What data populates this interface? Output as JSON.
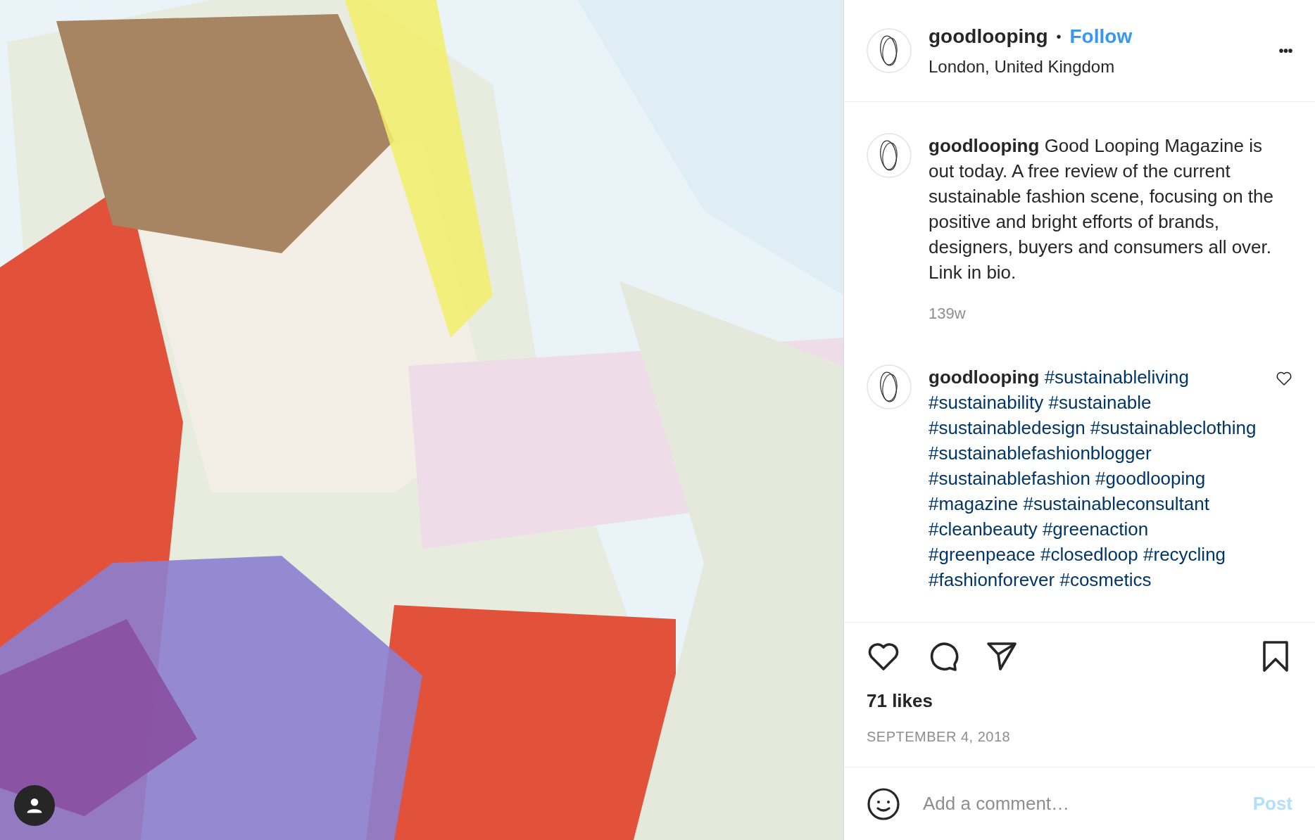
{
  "header": {
    "username": "goodlooping",
    "separator": "•",
    "follow": "Follow",
    "location": "London, United Kingdom",
    "more": "•••"
  },
  "comments": [
    {
      "kind": "caption",
      "username": "goodlooping",
      "text": "Good Looping Magazine is out today. A free review of the current sustainable fashion scene, focusing on the positive and bright efforts of brands, designers, buyers and consumers all over. Link in bio.",
      "time": "139w"
    },
    {
      "kind": "hashtags",
      "username": "goodlooping",
      "text": "#sustainableliving #sustainability #sustainable #sustainabledesign #sustainableclothing #sustainablefashionblogger #sustainablefashion #goodlooping #magazine #sustainableconsultant #cleanbeauty #greenaction #greenpeace #closedloop #recycling #fashionforever #cosmetics",
      "liked": false
    }
  ],
  "actions": {
    "liked": false,
    "saved": false,
    "likes": "71 likes",
    "date": "SEPTEMBER 4, 2018"
  },
  "comment_box": {
    "placeholder": "Add a comment…",
    "post": "Post",
    "disabled": true
  }
}
